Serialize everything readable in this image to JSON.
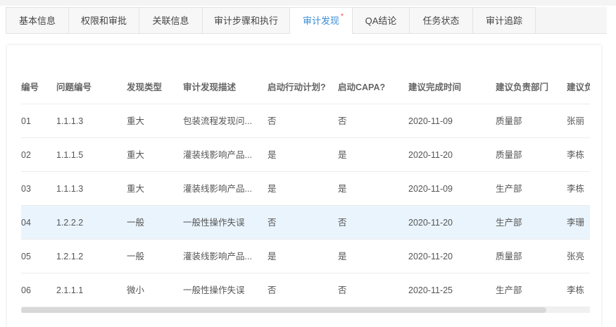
{
  "tabs": [
    {
      "label": "基本信息",
      "active": false
    },
    {
      "label": "权限和审批",
      "active": false
    },
    {
      "label": "关联信息",
      "active": false
    },
    {
      "label": "审计步骤和执行",
      "active": false
    },
    {
      "label": "审计发现",
      "active": true,
      "required_mark": "*"
    },
    {
      "label": "QA结论",
      "active": false
    },
    {
      "label": "任务状态",
      "active": false
    },
    {
      "label": "审计追踪",
      "active": false
    }
  ],
  "table": {
    "columns": [
      "编号",
      "问题编号",
      "发现类型",
      "审计发现描述",
      "启动行动计划?",
      "启动CAPA?",
      "建议完成时间",
      "建议负责部门",
      "建议负"
    ],
    "rows": [
      [
        "01",
        "1.1.1.3",
        "重大",
        "包装流程发现问...",
        "否",
        "否",
        "2020-11-09",
        "质量部",
        "张丽"
      ],
      [
        "02",
        "1.1.1.5",
        "重大",
        "灌装线影响产品...",
        "是",
        "是",
        "2020-11-20",
        "质量部",
        "李栋"
      ],
      [
        "03",
        "1.1.1.3",
        "重大",
        "灌装线影响产品...",
        "是",
        "是",
        "2020-11-09",
        "生产部",
        "李栋"
      ],
      [
        "04",
        "1.2.2.2",
        "一般",
        "一般性操作失误",
        "否",
        "否",
        "2020-11-20",
        "生产部",
        "李珊"
      ],
      [
        "05",
        "1.2.1.2",
        "一般",
        "灌装线影响产品...",
        "是",
        "是",
        "2020-11-20",
        "质量部",
        "张亮"
      ],
      [
        "06",
        "2.1.1.1",
        "微小",
        "一般性操作失误",
        "否",
        "否",
        "2020-11-25",
        "生产部",
        "李栋"
      ]
    ],
    "highlighted_row": 3
  },
  "colors": {
    "accent": "#3b8ed4",
    "highlight": "#eaf4fd",
    "required": "#e54545"
  }
}
